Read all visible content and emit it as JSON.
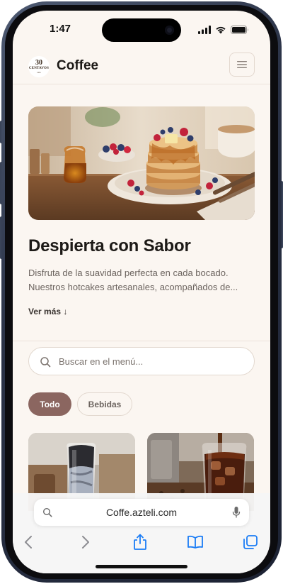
{
  "status_bar": {
    "time": "1:47"
  },
  "header": {
    "logo": {
      "number": "30",
      "name": "CENTAVOS",
      "tagline": "cafe"
    },
    "title": "Coffee"
  },
  "hero": {
    "image": "pancakes-with-berries-and-syrup",
    "title": "Despierta con Sabor",
    "description_lines": [
      "Disfruta de la suavidad perfecta en cada bocado.",
      "Nuestros hotcakes artesanales, acompañados de..."
    ],
    "see_more": "Ver más ↓"
  },
  "search": {
    "placeholder": "Buscar en el menú..."
  },
  "categories": [
    {
      "label": "Todo",
      "active": true
    },
    {
      "label": "Bebidas",
      "active": false
    }
  ],
  "products": [
    {
      "image": "iced-charcoal-latte"
    },
    {
      "image": "iced-cold-brew-coffee"
    }
  ],
  "browser": {
    "url": "Coffe.azteli.com"
  },
  "colors": {
    "background": "#fbf6f1",
    "accent": "#8b6660",
    "browser_blue": "#1a7cf5"
  }
}
